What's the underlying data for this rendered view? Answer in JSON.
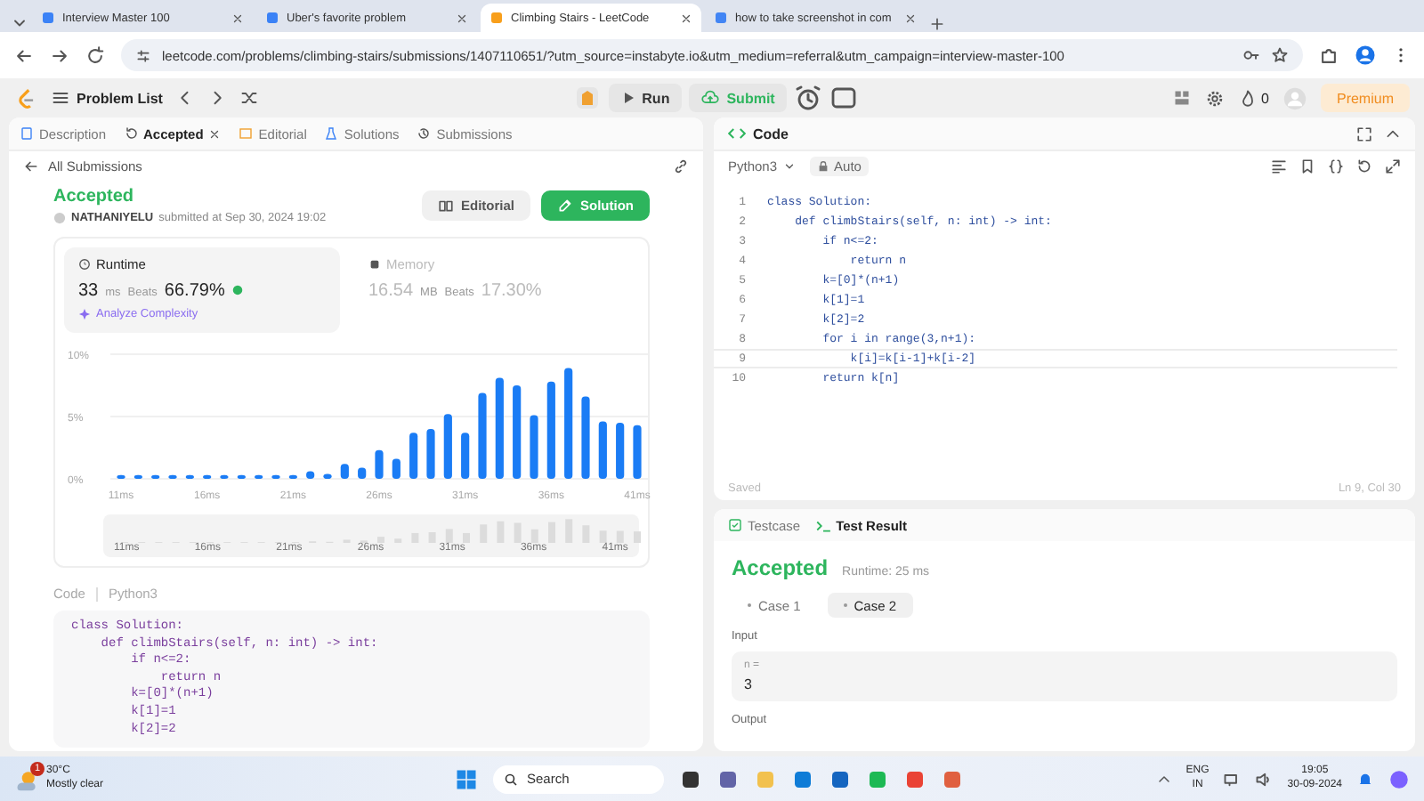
{
  "browser": {
    "tabs": [
      {
        "title": "Interview Master 100",
        "selected": false
      },
      {
        "title": "Uber's favorite problem",
        "selected": false
      },
      {
        "title": "Climbing Stairs - LeetCode",
        "selected": true
      },
      {
        "title": "how to take screenshot in com",
        "selected": false
      }
    ],
    "url": "leetcode.com/problems/climbing-stairs/submissions/1407110651/?utm_source=instabyte.io&utm_medium=referral&utm_campaign=interview-master-100"
  },
  "navbar": {
    "problem_list": "Problem List",
    "run": "Run",
    "submit": "Submit",
    "streak": "0",
    "premium": "Premium"
  },
  "left_panel": {
    "tabs": [
      {
        "label": "Description",
        "selected": false
      },
      {
        "label": "Accepted",
        "selected": true
      },
      {
        "label": "Editorial",
        "selected": false
      },
      {
        "label": "Solutions",
        "selected": false
      },
      {
        "label": "Submissions",
        "selected": false
      }
    ],
    "back_link": "All Submissions",
    "status": "Accepted",
    "user": "NATHANIYELU",
    "submitted": "submitted at Sep 30, 2024 19:02",
    "buttons": [
      {
        "label": "Editorial",
        "kind": "secondary"
      },
      {
        "label": "Solution",
        "kind": "primary"
      }
    ],
    "metrics": [
      {
        "title": "Runtime",
        "value": "33",
        "unit": "ms",
        "beats_label": "Beats",
        "beats": "66.79%",
        "selected": true,
        "link": "Analyze Complexity"
      },
      {
        "title": "Memory",
        "value": "16.54",
        "unit": "MB",
        "beats_label": "Beats",
        "beats": "17.30%",
        "selected": false
      }
    ],
    "chart_data": {
      "type": "bar",
      "x": [
        11,
        12,
        13,
        14,
        15,
        16,
        17,
        18,
        19,
        20,
        21,
        22,
        23,
        24,
        25,
        26,
        27,
        28,
        29,
        30,
        31,
        32,
        33,
        34,
        35,
        36,
        37,
        38,
        39,
        40,
        41
      ],
      "values": [
        0.3,
        0.3,
        0.3,
        0.3,
        0.3,
        0.3,
        0.3,
        0.3,
        0.3,
        0.3,
        0.3,
        0.6,
        0.4,
        1.2,
        0.9,
        2.3,
        1.6,
        3.7,
        4.0,
        5.2,
        3.7,
        6.9,
        8.1,
        7.5,
        5.1,
        7.8,
        8.9,
        6.6,
        4.6,
        4.5,
        4.3
      ],
      "xlim": [
        11,
        41
      ],
      "ylim": [
        0,
        10
      ],
      "xticks": [
        {
          "value": 11,
          "label": "11ms"
        },
        {
          "value": 16,
          "label": "16ms"
        },
        {
          "value": 21,
          "label": "21ms"
        },
        {
          "value": 26,
          "label": "26ms"
        },
        {
          "value": 31,
          "label": "31ms"
        },
        {
          "value": 36,
          "label": "36ms"
        },
        {
          "value": 41,
          "label": "41ms"
        }
      ],
      "yticks": [
        {
          "value": 0,
          "label": "0%"
        },
        {
          "value": 5,
          "label": "5%"
        },
        {
          "value": 10,
          "label": "10%"
        }
      ]
    },
    "overview_ticks": [
      "11ms",
      "16ms",
      "21ms",
      "26ms",
      "31ms",
      "36ms",
      "41ms"
    ],
    "code_label": "Code",
    "code_language": "Python3",
    "code": [
      "class Solution:",
      "    def climbStairs(self, n: int) -> int:",
      "        if n<=2:",
      "            return n",
      "        k=[0]*(n+1)",
      "        k[1]=1",
      "        k[2]=2"
    ]
  },
  "editor": {
    "title": "Code",
    "language": "Python3",
    "mode": "Auto",
    "lines": [
      {
        "number": "1",
        "text": "class Solution:",
        "current": false
      },
      {
        "number": "2",
        "text": "    def climbStairs(self, n: int) -> int:",
        "current": false
      },
      {
        "number": "3",
        "text": "        if n<=2:",
        "current": false
      },
      {
        "number": "4",
        "text": "            return n",
        "current": false
      },
      {
        "number": "5",
        "text": "        k=[0]*(n+1)",
        "current": false
      },
      {
        "number": "6",
        "text": "        k[1]=1",
        "current": false
      },
      {
        "number": "7",
        "text": "        k[2]=2",
        "current": false
      },
      {
        "number": "8",
        "text": "        for i in range(3,n+1):",
        "current": false
      },
      {
        "number": "9",
        "text": "            k[i]=k[i-1]+k[i-2]",
        "current": true
      },
      {
        "number": "10",
        "text": "        return k[n]",
        "current": false
      }
    ],
    "status": "Saved",
    "cursor": "Ln 9, Col 30"
  },
  "results": {
    "tabs": [
      {
        "label": "Testcase",
        "selected": false
      },
      {
        "label": "Test Result",
        "selected": true
      }
    ],
    "verdict": "Accepted",
    "runtime": "Runtime: 25 ms",
    "cases": [
      {
        "label": "Case 1",
        "selected": false
      },
      {
        "label": "Case 2",
        "selected": true
      }
    ],
    "input_label": "Input",
    "param": "n =",
    "param_value": "3",
    "output_label": "Output"
  },
  "taskbar": {
    "weather_temp": "30°C",
    "weather_text": "Mostly clear",
    "weather_badge": "1",
    "search": "Search",
    "lang": "ENG",
    "region": "IN",
    "time": "19:05",
    "date": "30-09-2024"
  }
}
